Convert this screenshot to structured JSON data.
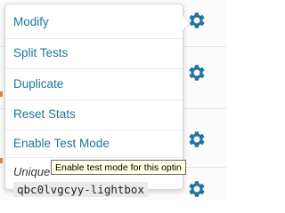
{
  "menu": {
    "items": [
      {
        "label": "Modify"
      },
      {
        "label": "Split Tests"
      },
      {
        "label": "Duplicate"
      },
      {
        "label": "Reset Stats"
      },
      {
        "label": "Enable Test Mode"
      }
    ],
    "unique_label": "Unique",
    "unique_code": "qbc0lvgcyy-lightbox"
  },
  "tooltip": {
    "text": "Enable test mode for this optin"
  },
  "colors": {
    "link": "#21759b",
    "gear": "#21759b",
    "tooltip_bg": "#ffffe1",
    "orange_accent": "#e2883b"
  },
  "icons": [
    "gear-icon"
  ]
}
